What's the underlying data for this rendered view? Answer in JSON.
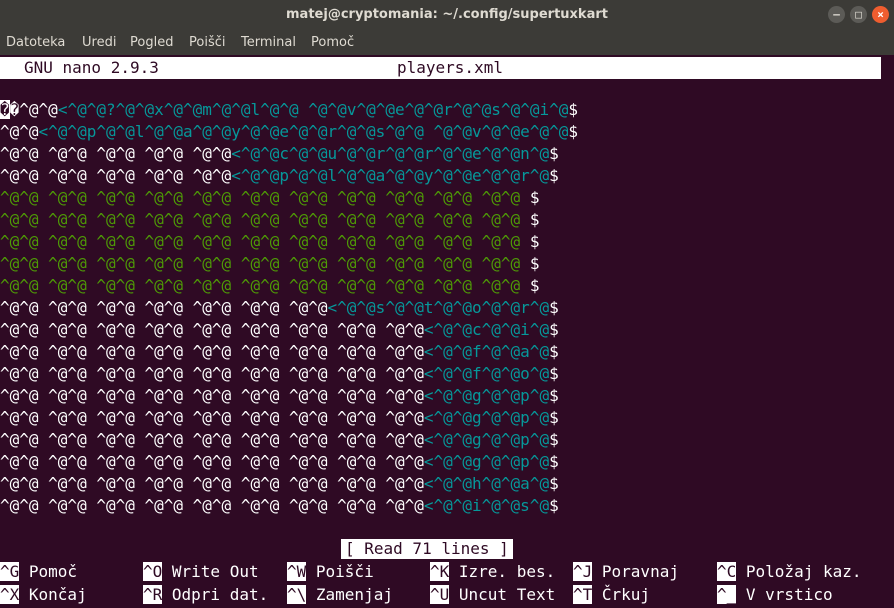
{
  "window": {
    "title": "matej@cryptomania: ~/.config/supertuxkart"
  },
  "menu": [
    "Datoteka",
    "Uredi",
    "Pogled",
    "Poišči",
    "Terminal",
    "Pomoč"
  ],
  "nano": {
    "version": "GNU nano 2.9.3",
    "filename": "players.xml",
    "status": "[ Read 71 lines ]"
  },
  "colors": {
    "white": "#ffffff",
    "cyan": "#06989a",
    "green": "#4e9a06",
    "background": "#2f0a24"
  },
  "lines": [
    [
      {
        "c": "cur",
        "t": "�"
      },
      {
        "c": "w",
        "t": "�^@^@"
      },
      {
        "c": "c",
        "t": "<^@^@?^@^@x^@^@m^@^@l^@^@"
      },
      {
        "c": "w",
        "t": " "
      },
      {
        "c": "c",
        "t": "^@^@v^@^@e^@^@r^@^@s^@^@i^@"
      },
      {
        "c": "w",
        "t": "$"
      }
    ],
    [
      {
        "c": "w",
        "t": "^@^@"
      },
      {
        "c": "c",
        "t": "<^@^@p^@^@l^@^@a^@^@y^@^@e^@^@r^@^@s^@^@"
      },
      {
        "c": "w",
        "t": " "
      },
      {
        "c": "c",
        "t": "^@^@v^@^@e^@^@"
      },
      {
        "c": "w",
        "t": "$"
      }
    ],
    [
      {
        "c": "w",
        "t": "^@^@ ^@^@ ^@^@ ^@^@ ^@^@"
      },
      {
        "c": "c",
        "t": "<^@^@c^@^@u^@^@r^@^@r^@^@e^@^@n^@"
      },
      {
        "c": "w",
        "t": "$"
      }
    ],
    [
      {
        "c": "w",
        "t": "^@^@ ^@^@ ^@^@ ^@^@ ^@^@"
      },
      {
        "c": "c",
        "t": "<^@^@p^@^@l^@^@a^@^@y^@^@e^@^@r^@"
      },
      {
        "c": "w",
        "t": "$"
      }
    ],
    [
      {
        "c": "g",
        "t": "^@^@ ^@^@ ^@^@ ^@^@ ^@^@ ^@^@ ^@^@ ^@^@ ^@^@ ^@^@ ^@^@ "
      },
      {
        "c": "w",
        "t": "$"
      }
    ],
    [
      {
        "c": "g",
        "t": "^@^@ ^@^@ ^@^@ ^@^@ ^@^@ ^@^@ ^@^@ ^@^@ ^@^@ ^@^@ ^@^@ "
      },
      {
        "c": "w",
        "t": "$"
      }
    ],
    [
      {
        "c": "g",
        "t": "^@^@ ^@^@ ^@^@ ^@^@ ^@^@ ^@^@ ^@^@ ^@^@ ^@^@ ^@^@ ^@^@ "
      },
      {
        "c": "w",
        "t": "$"
      }
    ],
    [
      {
        "c": "g",
        "t": "^@^@ ^@^@ ^@^@ ^@^@ ^@^@ ^@^@ ^@^@ ^@^@ ^@^@ ^@^@ ^@^@ "
      },
      {
        "c": "w",
        "t": "$"
      }
    ],
    [
      {
        "c": "g",
        "t": "^@^@ ^@^@ ^@^@ ^@^@ ^@^@ ^@^@ ^@^@ ^@^@ ^@^@ ^@^@ ^@^@ "
      },
      {
        "c": "w",
        "t": "$"
      }
    ],
    [
      {
        "c": "w",
        "t": "^@^@ ^@^@ ^@^@ ^@^@ ^@^@ ^@^@ ^@^@"
      },
      {
        "c": "c",
        "t": "<^@^@s^@^@t^@^@o^@^@r^@"
      },
      {
        "c": "w",
        "t": "$"
      }
    ],
    [
      {
        "c": "w",
        "t": "^@^@ ^@^@ ^@^@ ^@^@ ^@^@ ^@^@ ^@^@ ^@^@ ^@^@"
      },
      {
        "c": "c",
        "t": "<^@^@c^@^@i^@"
      },
      {
        "c": "w",
        "t": "$"
      }
    ],
    [
      {
        "c": "w",
        "t": "^@^@ ^@^@ ^@^@ ^@^@ ^@^@ ^@^@ ^@^@ ^@^@ ^@^@"
      },
      {
        "c": "c",
        "t": "<^@^@f^@^@a^@"
      },
      {
        "c": "w",
        "t": "$"
      }
    ],
    [
      {
        "c": "w",
        "t": "^@^@ ^@^@ ^@^@ ^@^@ ^@^@ ^@^@ ^@^@ ^@^@ ^@^@"
      },
      {
        "c": "c",
        "t": "<^@^@f^@^@o^@"
      },
      {
        "c": "w",
        "t": "$"
      }
    ],
    [
      {
        "c": "w",
        "t": "^@^@ ^@^@ ^@^@ ^@^@ ^@^@ ^@^@ ^@^@ ^@^@ ^@^@"
      },
      {
        "c": "c",
        "t": "<^@^@g^@^@p^@"
      },
      {
        "c": "w",
        "t": "$"
      }
    ],
    [
      {
        "c": "w",
        "t": "^@^@ ^@^@ ^@^@ ^@^@ ^@^@ ^@^@ ^@^@ ^@^@ ^@^@"
      },
      {
        "c": "c",
        "t": "<^@^@g^@^@p^@"
      },
      {
        "c": "w",
        "t": "$"
      }
    ],
    [
      {
        "c": "w",
        "t": "^@^@ ^@^@ ^@^@ ^@^@ ^@^@ ^@^@ ^@^@ ^@^@ ^@^@"
      },
      {
        "c": "c",
        "t": "<^@^@g^@^@p^@"
      },
      {
        "c": "w",
        "t": "$"
      }
    ],
    [
      {
        "c": "w",
        "t": "^@^@ ^@^@ ^@^@ ^@^@ ^@^@ ^@^@ ^@^@ ^@^@ ^@^@"
      },
      {
        "c": "c",
        "t": "<^@^@g^@^@p^@"
      },
      {
        "c": "w",
        "t": "$"
      }
    ],
    [
      {
        "c": "w",
        "t": "^@^@ ^@^@ ^@^@ ^@^@ ^@^@ ^@^@ ^@^@ ^@^@ ^@^@"
      },
      {
        "c": "c",
        "t": "<^@^@h^@^@a^@"
      },
      {
        "c": "w",
        "t": "$"
      }
    ],
    [
      {
        "c": "w",
        "t": "^@^@ ^@^@ ^@^@ ^@^@ ^@^@ ^@^@ ^@^@ ^@^@ ^@^@"
      },
      {
        "c": "c",
        "t": "<^@^@i^@^@s^@"
      },
      {
        "c": "w",
        "t": "$"
      }
    ]
  ],
  "shortcuts": [
    [
      {
        "key": "^G",
        "label": "Pomoč"
      },
      {
        "key": "^O",
        "label": "Write Out"
      },
      {
        "key": "^W",
        "label": "Poišči"
      },
      {
        "key": "^K",
        "label": "Izre. bes."
      },
      {
        "key": "^J",
        "label": "Poravnaj"
      },
      {
        "key": "^C",
        "label": "Položaj kaz."
      }
    ],
    [
      {
        "key": "^X",
        "label": "Končaj"
      },
      {
        "key": "^R",
        "label": "Odpri dat."
      },
      {
        "key": "^\\",
        "label": "Zamenjaj"
      },
      {
        "key": "^U",
        "label": "Uncut Text"
      },
      {
        "key": "^T",
        "label": "Črkuj"
      },
      {
        "key": "^_",
        "label": "V vrstico"
      }
    ]
  ]
}
